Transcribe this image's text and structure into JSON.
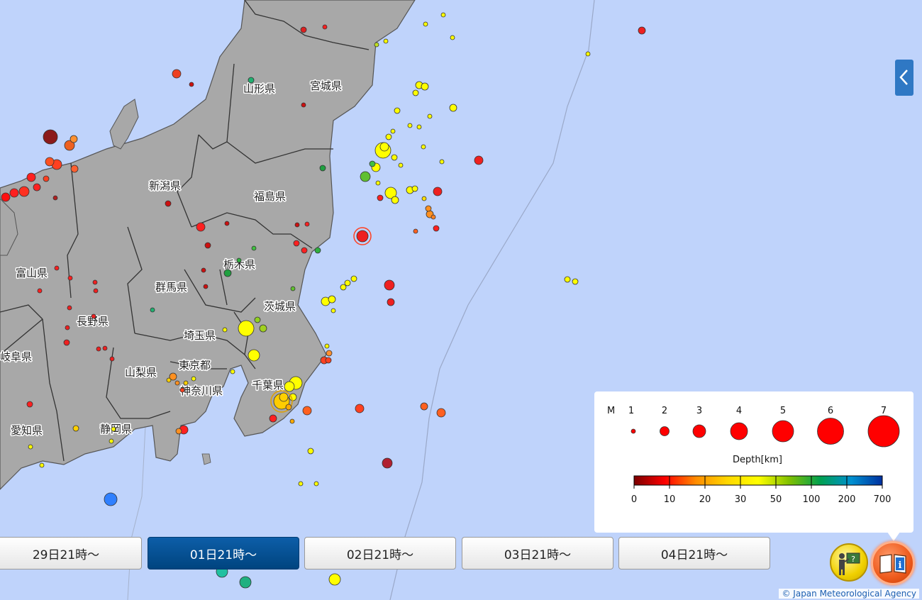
{
  "prefectures": [
    {
      "name": "宮城県"
    },
    {
      "name": "山形県"
    },
    {
      "name": "新潟県"
    },
    {
      "name": "福島県"
    },
    {
      "name": "栃木県"
    },
    {
      "name": "富山県"
    },
    {
      "name": "群馬県"
    },
    {
      "name": "長野県"
    },
    {
      "name": "茨城県"
    },
    {
      "name": "埼玉県"
    },
    {
      "name": "岐阜県"
    },
    {
      "name": "東京都"
    },
    {
      "name": "山梨県"
    },
    {
      "name": "千葉県"
    },
    {
      "name": "神奈川県"
    },
    {
      "name": "愛知県"
    },
    {
      "name": "静岡県"
    }
  ],
  "tabs": [
    {
      "label": "29日21時～",
      "active": false
    },
    {
      "label": "01日21時～",
      "active": true
    },
    {
      "label": "02日21時～",
      "active": false
    },
    {
      "label": "03日21時～",
      "active": false
    },
    {
      "label": "04日21時～",
      "active": false
    }
  ],
  "legend": {
    "magnitude_title": "M",
    "magnitudes": [
      "1",
      "2",
      "3",
      "4",
      "5",
      "6",
      "7"
    ],
    "depth_title": "Depth[km]",
    "depth_ticks": [
      "0",
      "10",
      "20",
      "30",
      "50",
      "100",
      "200",
      "700"
    ],
    "depth_colors": [
      "#7a0000",
      "#ff0000",
      "#ff8c00",
      "#ffd700",
      "#ffff00",
      "#80c000",
      "#00a050",
      "#0090d0",
      "#0030a0"
    ]
  },
  "copyright": "© Japan Meteorological Agency",
  "icons": {
    "side_toggle": "chevron-left-icon",
    "teacher": "teacher-icon",
    "info": "book-info-icon"
  }
}
